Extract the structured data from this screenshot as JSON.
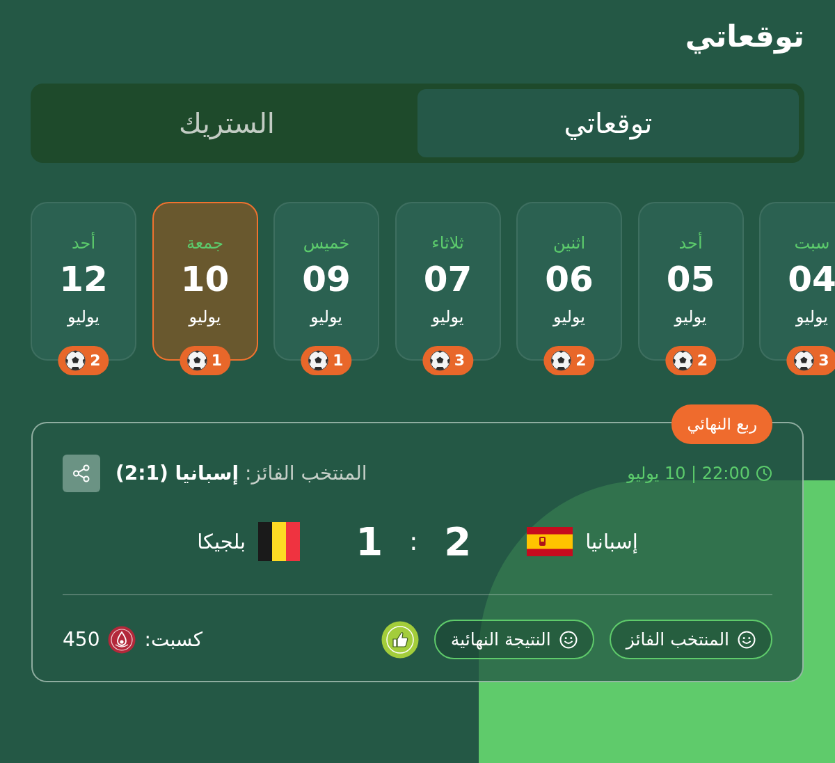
{
  "title": "توقعاتي",
  "tabs": [
    {
      "label": "توقعاتي",
      "selected": true
    },
    {
      "label": "الستريك",
      "selected": false
    }
  ],
  "days": [
    {
      "weekday": "سبت",
      "day": "04",
      "month": "يوليو",
      "matches": "3",
      "selected": false
    },
    {
      "weekday": "أحد",
      "day": "05",
      "month": "يوليو",
      "matches": "2",
      "selected": false
    },
    {
      "weekday": "اثنين",
      "day": "06",
      "month": "يوليو",
      "matches": "2",
      "selected": false
    },
    {
      "weekday": "ثلاثاء",
      "day": "07",
      "month": "يوليو",
      "matches": "3",
      "selected": false
    },
    {
      "weekday": "خميس",
      "day": "09",
      "month": "يوليو",
      "matches": "1",
      "selected": false
    },
    {
      "weekday": "جمعة",
      "day": "10",
      "month": "يوليو",
      "matches": "1",
      "selected": true
    },
    {
      "weekday": "أحد",
      "day": "12",
      "month": "يوليو",
      "matches": "2",
      "selected": false
    }
  ],
  "match": {
    "stage": "ربع النهائي",
    "time": "22:00 | 10 يوليو",
    "winner": "المنتخب الفائز: **إسبانيا (2:1)**",
    "teams": [
      {
        "name": "إسبانيا",
        "flag": {
          "kind": "spain"
        },
        "score": "2"
      },
      {
        "name": "بلجيكا",
        "flag": {
          "kind": "belgium"
        },
        "score": "1"
      }
    ],
    "score_separator": ":",
    "predictions": [
      "المنتخب الفائز",
      "النتيجة النهائية"
    ],
    "earned": {
      "label": "كسبت:",
      "points": "450"
    }
  }
}
